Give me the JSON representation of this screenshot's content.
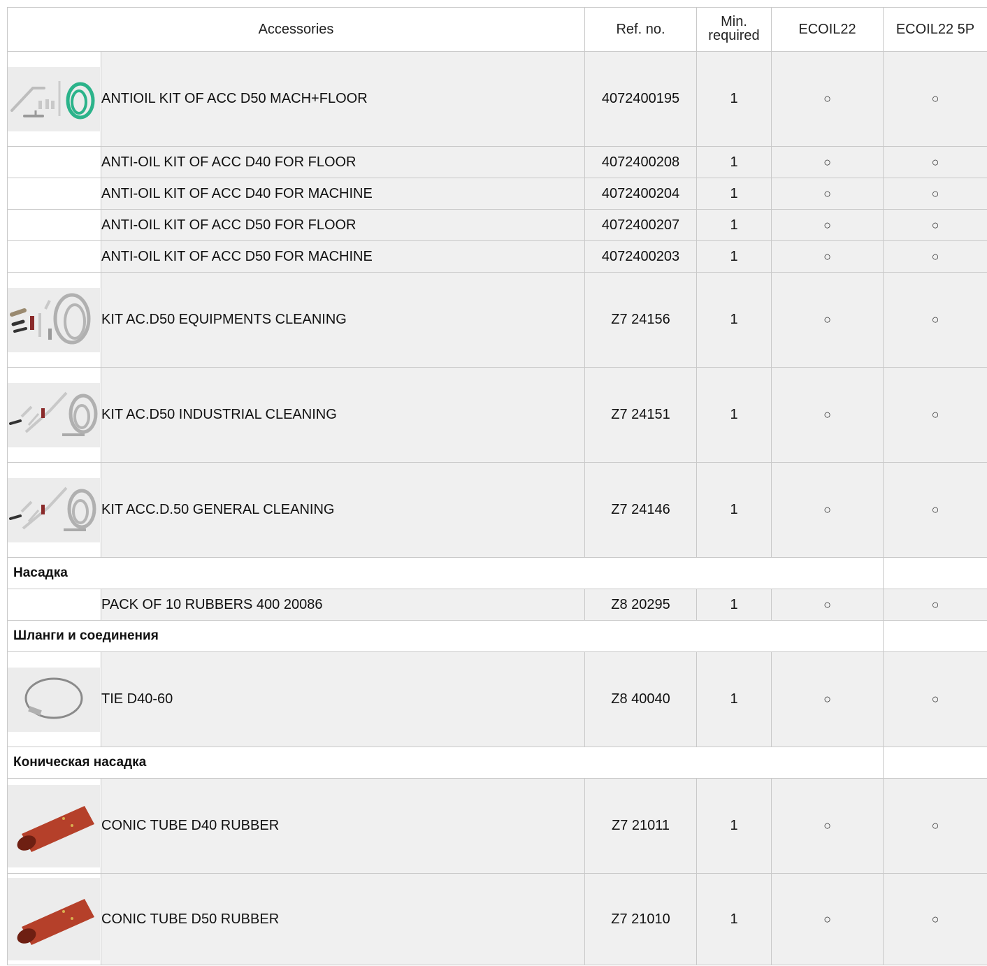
{
  "headers": {
    "accessories": "Accessories",
    "ref": "Ref. no.",
    "min_line1": "Min.",
    "min_line2": "required",
    "col1": "ECOIL22",
    "col2": "ECOIL22 5P"
  },
  "mark": "○",
  "rows": [
    {
      "name": "ANTIOIL KIT OF ACC D50  MACH+FLOOR",
      "ref": "4072400195",
      "min": "1",
      "image": "antioil-kit-green-hose"
    },
    {
      "name": "ANTI-OIL KIT OF ACC D40 FOR FLOOR",
      "ref": "4072400208",
      "min": "1"
    },
    {
      "name": "ANTI-OIL KIT OF ACC D40 FOR MACHINE",
      "ref": "4072400204",
      "min": "1"
    },
    {
      "name": "ANTI-OIL KIT OF ACC D50 FOR FLOOR",
      "ref": "4072400207",
      "min": "1"
    },
    {
      "name": "ANTI-OIL KIT OF ACC D50 FOR MACHINE",
      "ref": "4072400203",
      "min": "1"
    },
    {
      "name": "KIT AC.D50 EQUIPMENTS CLEANING",
      "ref": "Z7 24156",
      "min": "1",
      "image": "equipment-cleaning-kit"
    },
    {
      "name": "KIT AC.D50 INDUSTRIAL CLEANING",
      "ref": "Z7 24151",
      "min": "1",
      "image": "industrial-cleaning-kit"
    },
    {
      "name": "KIT ACC.D.50 GENERAL CLEANING",
      "ref": "Z7 24146",
      "min": "1",
      "image": "general-cleaning-kit"
    },
    {
      "name": "PACK OF 10 RUBBERS 400 20086",
      "ref": "Z8 20295",
      "min": "1"
    },
    {
      "name": "TIE D40-60",
      "ref": "Z8 40040",
      "min": "1",
      "image": "hose-clamp"
    },
    {
      "name": "CONIC TUBE D40 RUBBER",
      "ref": "Z7 21011",
      "min": "1",
      "image": "conic-rubber-tube"
    },
    {
      "name": "CONIC TUBE D50 RUBBER",
      "ref": "Z7 21010",
      "min": "1",
      "image": "conic-rubber-tube"
    }
  ],
  "categories": {
    "nozzle": "Насадка",
    "hoses": "Шланги и соединения",
    "conic": "Коническая насадка"
  },
  "colors": {
    "row_bg": "#f0f0f0",
    "border": "#c9c9c9",
    "hose_green": "#2bb38a",
    "rubber_red": "#b5402a",
    "metal": "#b8b8b8"
  }
}
